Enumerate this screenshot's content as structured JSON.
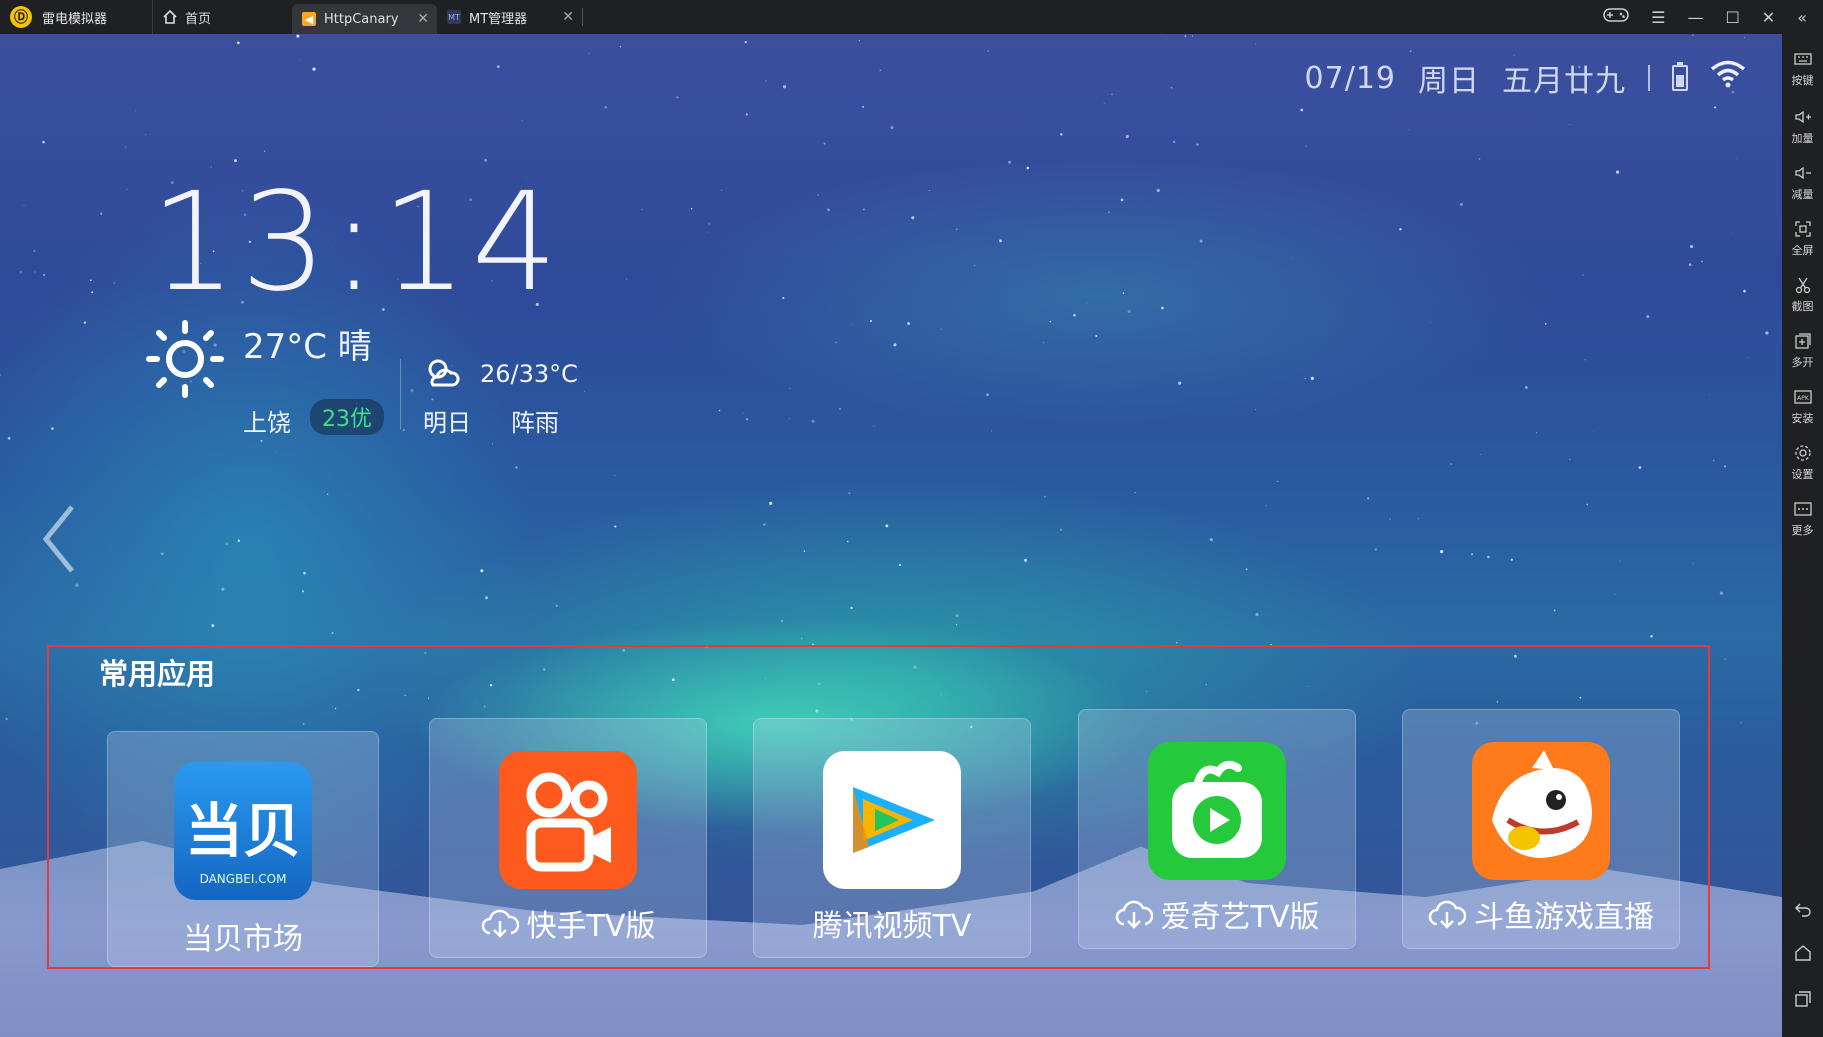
{
  "titlebar": {
    "app_name": "雷电模拟器",
    "tabs": [
      {
        "label": "首页",
        "icon": "home-icon"
      },
      {
        "label": "HttpCanary",
        "icon": "httpcanary-icon"
      },
      {
        "label": "MT管理器",
        "icon": "mt-manager-icon"
      }
    ],
    "controls": [
      "gamepad-icon",
      "menu-icon",
      "minimize-icon",
      "maximize-icon",
      "close-icon",
      "collapse-icon"
    ]
  },
  "status": {
    "date": "07/19",
    "weekday": "周日",
    "lunar": "五月廿九",
    "separator": "|"
  },
  "clock": "13:14",
  "weather": {
    "temperature": "27°C 晴",
    "city": "上饶",
    "aqi": "23优",
    "tomorrow_range": "26/33°C",
    "tomorrow_label": "明日",
    "tomorrow_condition": "阵雨"
  },
  "section": {
    "title": "常用应用",
    "apps": [
      {
        "name": "当贝市场",
        "downloadable": false
      },
      {
        "name": "快手TV版",
        "downloadable": true
      },
      {
        "name": "腾讯视频TV",
        "downloadable": false
      },
      {
        "name": "爱奇艺TV版",
        "downloadable": true
      },
      {
        "name": "斗鱼游戏直播",
        "downloadable": true
      }
    ],
    "dangbei_logo_text": "当贝",
    "dangbei_logo_sub": "DANGBEI.COM"
  },
  "toolbar": {
    "items": [
      "按键",
      "加量",
      "减量",
      "全屏",
      "截图",
      "多开",
      "安装",
      "设置",
      "更多"
    ]
  },
  "colors": {
    "accent_red": "#e53a3a",
    "aqi_green": "#3fe08a",
    "kuaishou": "#ff5a1e",
    "iqiyi": "#25c93c",
    "douyu": "#ff7a1a",
    "dangbei": "#1e88e5"
  }
}
